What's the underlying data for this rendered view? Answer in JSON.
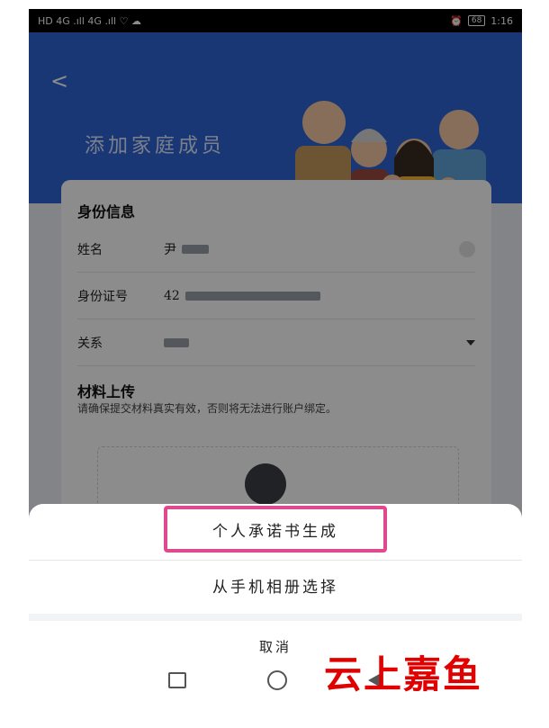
{
  "status_bar": {
    "left_icons": "HD 4G .ıll 4G .ıll ♡ ☁",
    "time": "1:16",
    "battery": "68"
  },
  "header": {
    "title": "添加家庭成员"
  },
  "identity": {
    "section_title": "身份信息",
    "name_label": "姓名",
    "name_value": "尹",
    "id_label": "身份证号",
    "id_value": "42",
    "relation_label": "关系"
  },
  "materials": {
    "section_title": "材料上传",
    "hint": "请确保提交材料真实有效，否则将无法进行账户绑定。"
  },
  "action_sheet": {
    "option1": "个人承诺书生成",
    "option2": "从手机相册选择",
    "cancel": "取消"
  },
  "watermark": "云上嘉鱼",
  "colors": {
    "header_blue": "#2f63d6",
    "highlight": "#e0488f",
    "watermark": "#e00000"
  }
}
